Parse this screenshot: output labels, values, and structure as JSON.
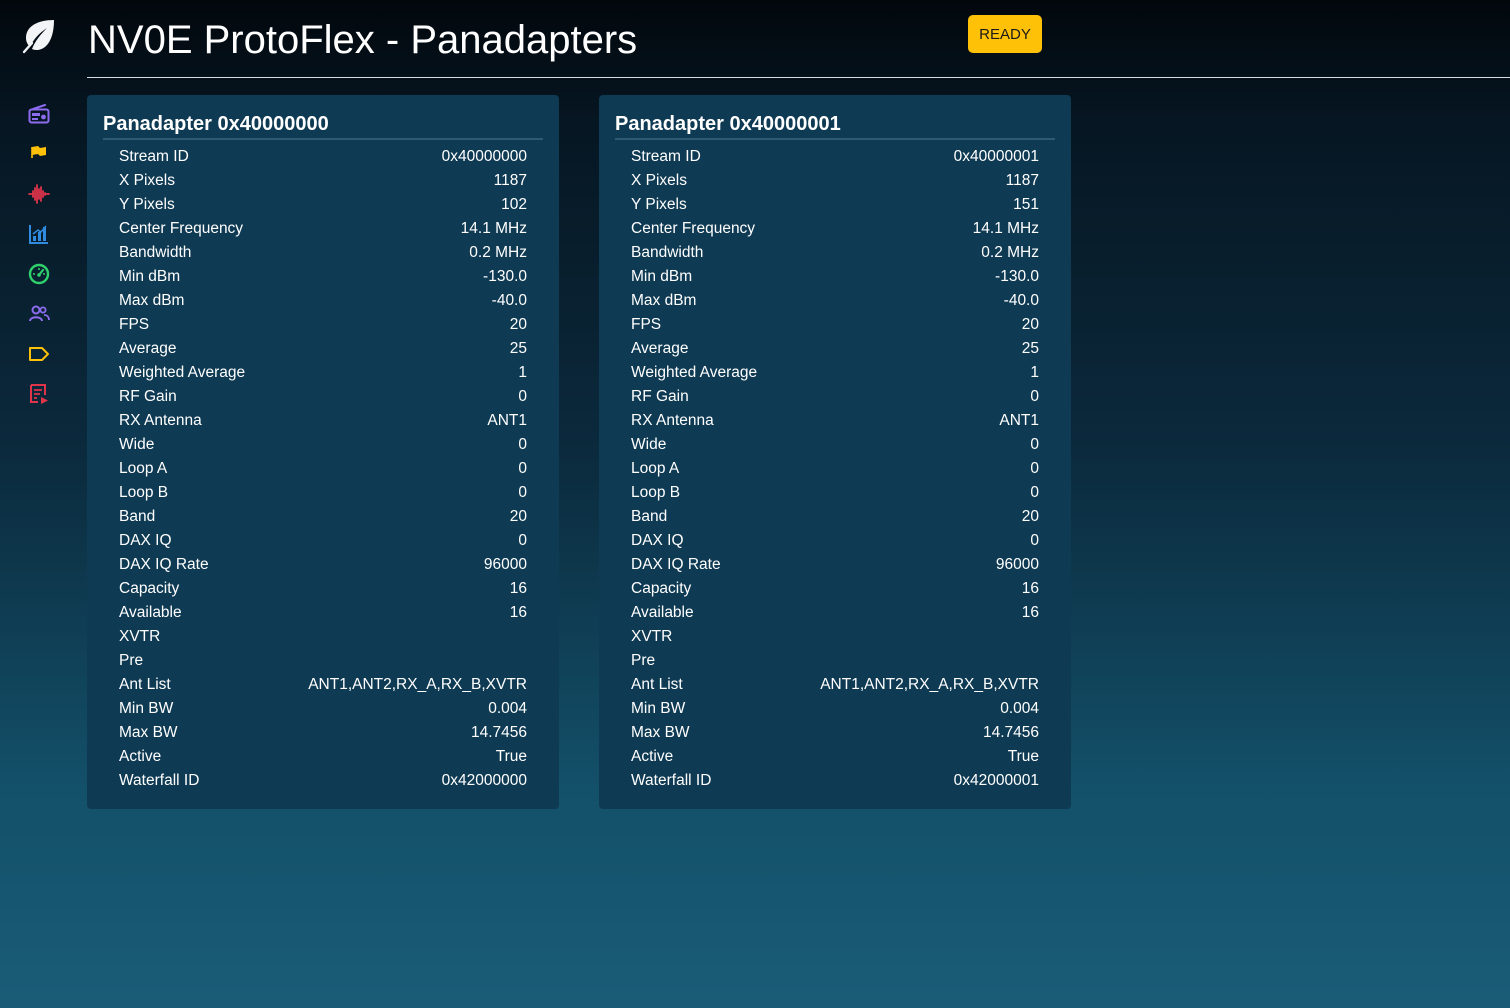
{
  "header": {
    "title": "NV0E ProtoFlex - Panadapters",
    "status": "READY"
  },
  "sidebar": {
    "logo_icon": "leaf-icon",
    "items": [
      {
        "icon": "radio-icon",
        "color": "#8e6cf0"
      },
      {
        "icon": "flag-icon",
        "color": "#ffc107"
      },
      {
        "icon": "audio-waveform-icon",
        "color": "#e0344b"
      },
      {
        "icon": "bar-chart-icon",
        "color": "#2f8be0"
      },
      {
        "icon": "gauge-icon",
        "color": "#2fd06c"
      },
      {
        "icon": "users-icon",
        "color": "#8e6cf0"
      },
      {
        "icon": "tag-icon",
        "color": "#ffc107"
      },
      {
        "icon": "log-icon",
        "color": "#e0344b"
      }
    ]
  },
  "colors": {
    "badge": "#ffc107",
    "card": "#0f3a53"
  },
  "panadapters": [
    {
      "title": "Panadapter 0x40000000",
      "rows": [
        {
          "label": "Stream ID",
          "value": "0x40000000"
        },
        {
          "label": "X Pixels",
          "value": "1187"
        },
        {
          "label": "Y Pixels",
          "value": "102"
        },
        {
          "label": "Center Frequency",
          "value": "14.1 MHz"
        },
        {
          "label": "Bandwidth",
          "value": "0.2 MHz"
        },
        {
          "label": "Min dBm",
          "value": "-130.0"
        },
        {
          "label": "Max dBm",
          "value": "-40.0"
        },
        {
          "label": "FPS",
          "value": "20"
        },
        {
          "label": "Average",
          "value": "25"
        },
        {
          "label": "Weighted Average",
          "value": "1"
        },
        {
          "label": "RF Gain",
          "value": "0"
        },
        {
          "label": "RX Antenna",
          "value": "ANT1"
        },
        {
          "label": "Wide",
          "value": "0"
        },
        {
          "label": "Loop A",
          "value": "0"
        },
        {
          "label": "Loop B",
          "value": "0"
        },
        {
          "label": "Band",
          "value": "20"
        },
        {
          "label": "DAX IQ",
          "value": "0"
        },
        {
          "label": "DAX IQ Rate",
          "value": "96000"
        },
        {
          "label": "Capacity",
          "value": "16"
        },
        {
          "label": "Available",
          "value": "16"
        },
        {
          "label": "XVTR",
          "value": ""
        },
        {
          "label": "Pre",
          "value": ""
        },
        {
          "label": "Ant List",
          "value": "ANT1,ANT2,RX_A,RX_B,XVTR"
        },
        {
          "label": "Min BW",
          "value": "0.004"
        },
        {
          "label": "Max BW",
          "value": "14.7456"
        },
        {
          "label": "Active",
          "value": "True"
        },
        {
          "label": "Waterfall ID",
          "value": "0x42000000"
        }
      ]
    },
    {
      "title": "Panadapter 0x40000001",
      "rows": [
        {
          "label": "Stream ID",
          "value": "0x40000001"
        },
        {
          "label": "X Pixels",
          "value": "1187"
        },
        {
          "label": "Y Pixels",
          "value": "151"
        },
        {
          "label": "Center Frequency",
          "value": "14.1 MHz"
        },
        {
          "label": "Bandwidth",
          "value": "0.2 MHz"
        },
        {
          "label": "Min dBm",
          "value": "-130.0"
        },
        {
          "label": "Max dBm",
          "value": "-40.0"
        },
        {
          "label": "FPS",
          "value": "20"
        },
        {
          "label": "Average",
          "value": "25"
        },
        {
          "label": "Weighted Average",
          "value": "1"
        },
        {
          "label": "RF Gain",
          "value": "0"
        },
        {
          "label": "RX Antenna",
          "value": "ANT1"
        },
        {
          "label": "Wide",
          "value": "0"
        },
        {
          "label": "Loop A",
          "value": "0"
        },
        {
          "label": "Loop B",
          "value": "0"
        },
        {
          "label": "Band",
          "value": "20"
        },
        {
          "label": "DAX IQ",
          "value": "0"
        },
        {
          "label": "DAX IQ Rate",
          "value": "96000"
        },
        {
          "label": "Capacity",
          "value": "16"
        },
        {
          "label": "Available",
          "value": "16"
        },
        {
          "label": "XVTR",
          "value": ""
        },
        {
          "label": "Pre",
          "value": ""
        },
        {
          "label": "Ant List",
          "value": "ANT1,ANT2,RX_A,RX_B,XVTR"
        },
        {
          "label": "Min BW",
          "value": "0.004"
        },
        {
          "label": "Max BW",
          "value": "14.7456"
        },
        {
          "label": "Active",
          "value": "True"
        },
        {
          "label": "Waterfall ID",
          "value": "0x42000001"
        }
      ]
    }
  ]
}
